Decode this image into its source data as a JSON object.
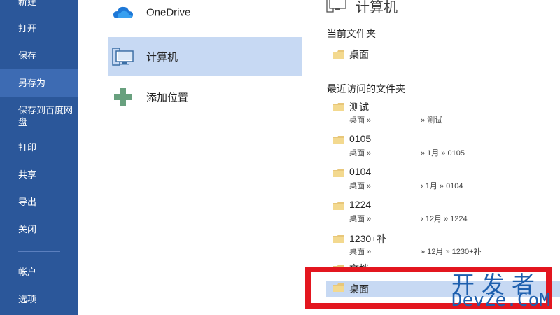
{
  "nav": {
    "items": [
      {
        "label": "新建"
      },
      {
        "label": "打开"
      },
      {
        "label": "保存"
      },
      {
        "label": "另存为",
        "selected": true
      },
      {
        "label": "保存到百度网盘"
      },
      {
        "label": "打印"
      },
      {
        "label": "共享"
      },
      {
        "label": "导出"
      },
      {
        "label": "关闭"
      },
      {
        "label": "帐户"
      },
      {
        "label": "选项"
      }
    ]
  },
  "locations": {
    "items": [
      {
        "label": "OneDrive",
        "icon": "cloud-icon"
      },
      {
        "label": "计算机",
        "icon": "computer-icon",
        "selected": true
      },
      {
        "label": "添加位置",
        "icon": "plus-icon"
      }
    ]
  },
  "pane": {
    "title": "计算机",
    "current_section": "当前文件夹",
    "current_folder": "桌面",
    "recent_section": "最近访问的文件夹",
    "recent": [
      {
        "name": "测试",
        "path_start": "桌面 »",
        "path_end": "» 测试"
      },
      {
        "name": "0105",
        "path_start": "桌面 »",
        "path_end": "» 1月 » 0105"
      },
      {
        "name": "0104",
        "path_start": "桌面 »",
        "path_end": "› 1月 » 0104"
      },
      {
        "name": "1224",
        "path_start": "桌面 »",
        "path_end": "› 12月 » 1224"
      },
      {
        "name": "1230+补",
        "path_start": "桌面 »",
        "path_end": "» 12月 » 1230+补"
      },
      {
        "name": "文档",
        "path_start": "",
        "path_end": ""
      },
      {
        "name": "桌面",
        "path_start": "",
        "path_end": ""
      }
    ]
  },
  "watermark": {
    "line1": "开发者",
    "line2": "DevZe.CoM"
  },
  "colors": {
    "nav_bg": "#2b579a",
    "nav_selected": "#3d6bb3",
    "selection": "#c7d9f3",
    "highlight_border": "#e3161f",
    "folder": "#e8c77a"
  }
}
